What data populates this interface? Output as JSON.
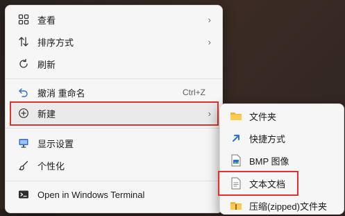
{
  "context_menu": {
    "items": [
      {
        "label": "查看",
        "icon": "grid-icon"
      },
      {
        "label": "排序方式",
        "icon": "sort-icon"
      },
      {
        "label": "刷新",
        "icon": "refresh-icon"
      },
      {
        "label": "撤消 重命名",
        "icon": "undo-icon",
        "shortcut": "Ctrl+Z"
      },
      {
        "label": "新建",
        "icon": "new-icon"
      },
      {
        "label": "显示设置",
        "icon": "monitor-icon"
      },
      {
        "label": "个性化",
        "icon": "brush-icon"
      },
      {
        "label": "Open in Windows Terminal",
        "icon": "terminal-icon"
      }
    ]
  },
  "new_submenu": {
    "items": [
      {
        "label": "文件夹",
        "icon": "folder-icon"
      },
      {
        "label": "快捷方式",
        "icon": "shortcut-icon"
      },
      {
        "label": "BMP 图像",
        "icon": "bmp-image-icon"
      },
      {
        "label": "文本文档",
        "icon": "text-document-icon"
      },
      {
        "label": "压缩(zipped)文件夹",
        "icon": "zip-folder-icon"
      }
    ]
  },
  "colors": {
    "highlight_box": "#e0322b",
    "menu_bg": "#f6f6f6",
    "accent": "#2b6fd6"
  }
}
